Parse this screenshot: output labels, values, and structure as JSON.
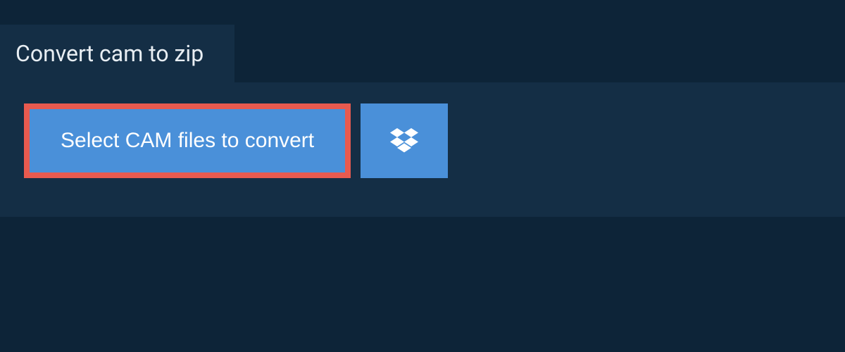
{
  "tab": {
    "title": "Convert cam to zip"
  },
  "actions": {
    "select_label": "Select CAM files to convert"
  },
  "colors": {
    "background": "#0d2438",
    "panel": "#142e45",
    "button": "#4a90d9",
    "highlight_border": "#e85a4f",
    "text_light": "#ffffff"
  }
}
